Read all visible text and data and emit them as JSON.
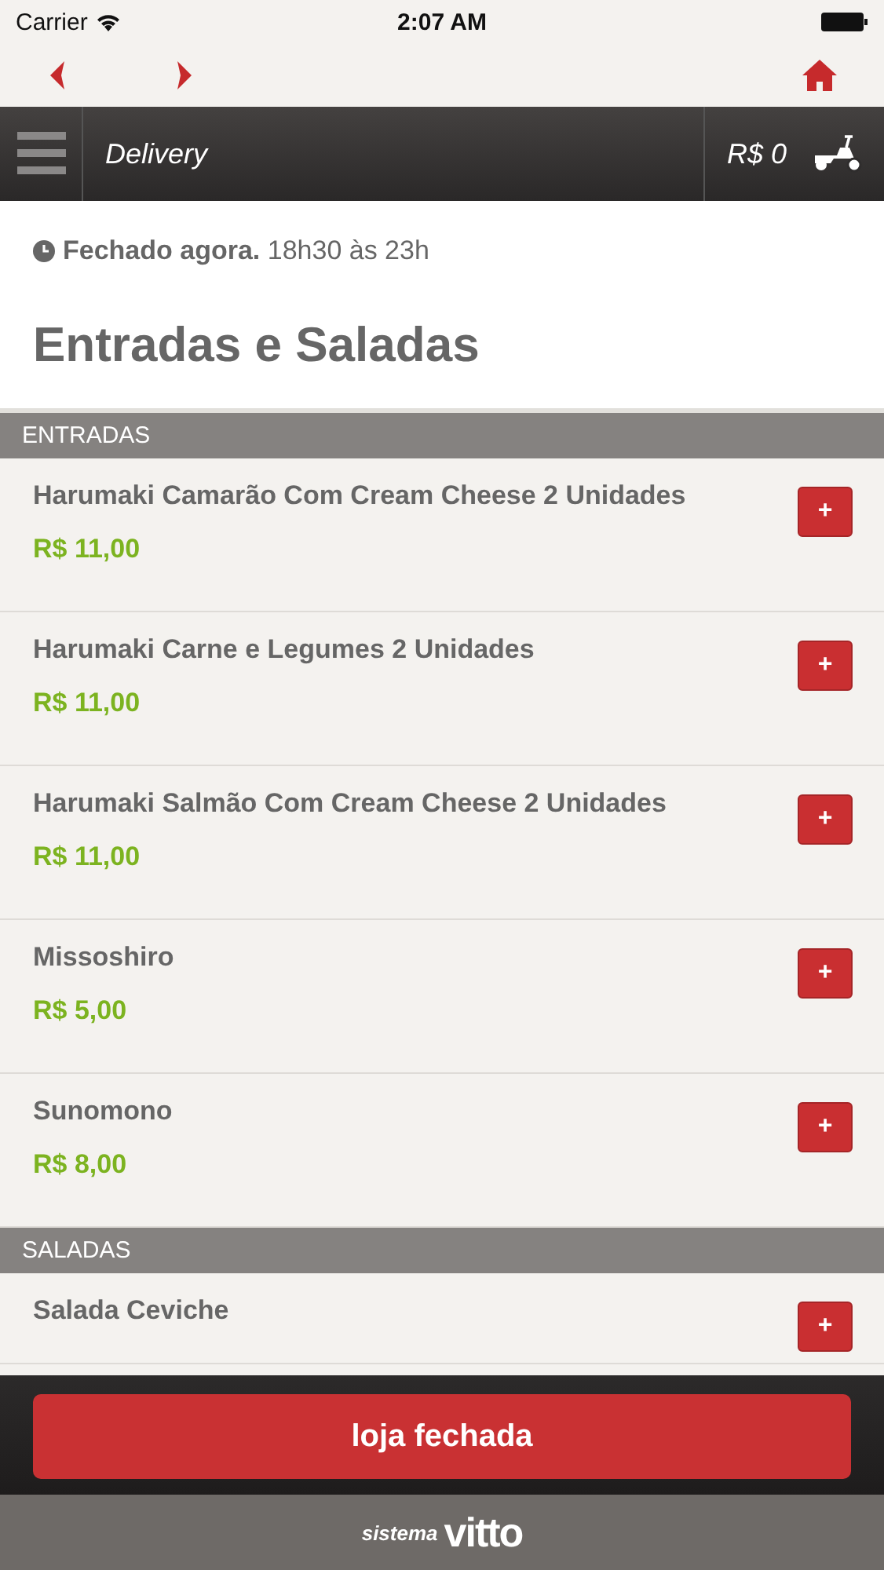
{
  "status_bar": {
    "carrier": "Carrier",
    "time": "2:07 AM"
  },
  "header": {
    "title": "Delivery",
    "cart_total": "R$ 0"
  },
  "store": {
    "status": "Fechado agora.",
    "hours": "18h30 às 23h"
  },
  "page_title": "Entradas e Saladas",
  "sections": [
    {
      "title": "ENTRADAS",
      "items": [
        {
          "name": "Harumaki Camarão Com Cream Cheese 2 Unidades",
          "price": "R$ 11,00",
          "add": "+"
        },
        {
          "name": "Harumaki Carne e Legumes 2 Unidades",
          "price": "R$ 11,00",
          "add": "+"
        },
        {
          "name": "Harumaki Salmão Com Cream Cheese 2 Unidades",
          "price": "R$ 11,00",
          "add": "+"
        },
        {
          "name": "Missoshiro",
          "price": "R$ 5,00",
          "add": "+"
        },
        {
          "name": "Sunomono",
          "price": "R$ 8,00",
          "add": "+"
        }
      ]
    },
    {
      "title": "SALADAS",
      "items": [
        {
          "name": "Salada Ceviche",
          "add": "+"
        }
      ]
    }
  ],
  "closed_button": "loja fechada",
  "footer": {
    "prefix": "sistema",
    "brand": "vitto"
  }
}
